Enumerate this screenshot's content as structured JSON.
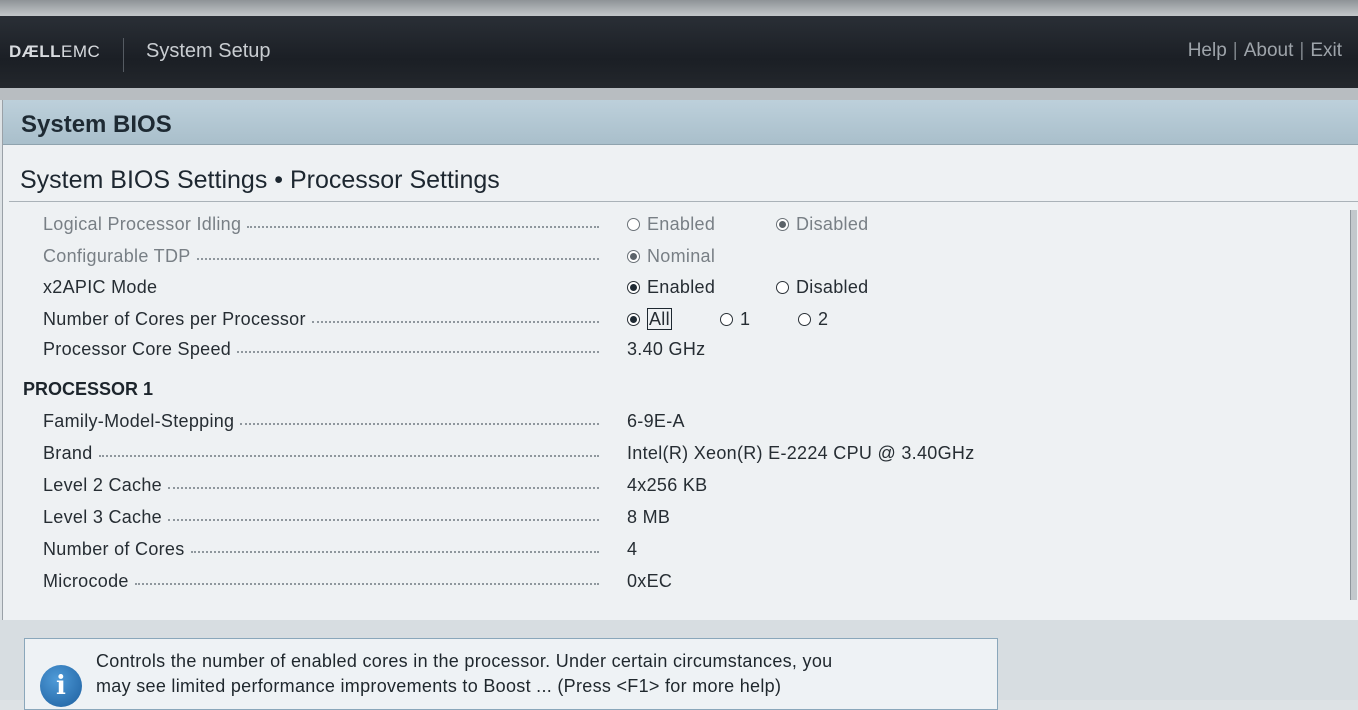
{
  "header": {
    "logo_bold": "DÆLL",
    "logo_light": "EMC",
    "title": "System Setup",
    "links": [
      "Help",
      "About",
      "Exit"
    ]
  },
  "page": {
    "section_title": "System BIOS",
    "breadcrumb": "System BIOS Settings • Processor Settings"
  },
  "settings": {
    "logical_idling": {
      "label": "Logical Processor Idling",
      "opt1": "Enabled",
      "opt2": "Disabled",
      "selected": "Disabled"
    },
    "tdp": {
      "label": "Configurable TDP",
      "opt1": "Nominal",
      "selected": "Nominal"
    },
    "x2apic": {
      "label": "x2APIC Mode",
      "opt1": "Enabled",
      "opt2": "Disabled",
      "selected": "Enabled"
    },
    "cores_per_proc": {
      "label": "Number of Cores per Processor",
      "opt1": "All",
      "opt2": "1",
      "opt3": "2",
      "selected": "All"
    },
    "core_speed": {
      "label": "Processor Core Speed",
      "value": "3.40 GHz"
    }
  },
  "processor1": {
    "heading": "PROCESSOR 1",
    "rows": [
      {
        "label": "Family-Model-Stepping",
        "value": "6-9E-A"
      },
      {
        "label": "Brand",
        "value": "Intel(R) Xeon(R) E-2224 CPU @ 3.40GHz"
      },
      {
        "label": "Level 2 Cache",
        "value": "4x256 KB"
      },
      {
        "label": "Level 3 Cache",
        "value": "8 MB"
      },
      {
        "label": "Number of Cores",
        "value": "4"
      },
      {
        "label": "Microcode",
        "value": "0xEC"
      }
    ]
  },
  "help": {
    "icon": "info-icon",
    "line1": "Controls the number of enabled cores in the processor. Under certain circumstances, you",
    "line2": "may see limited performance improvements to Boost ... (Press <F1> for more help)"
  }
}
